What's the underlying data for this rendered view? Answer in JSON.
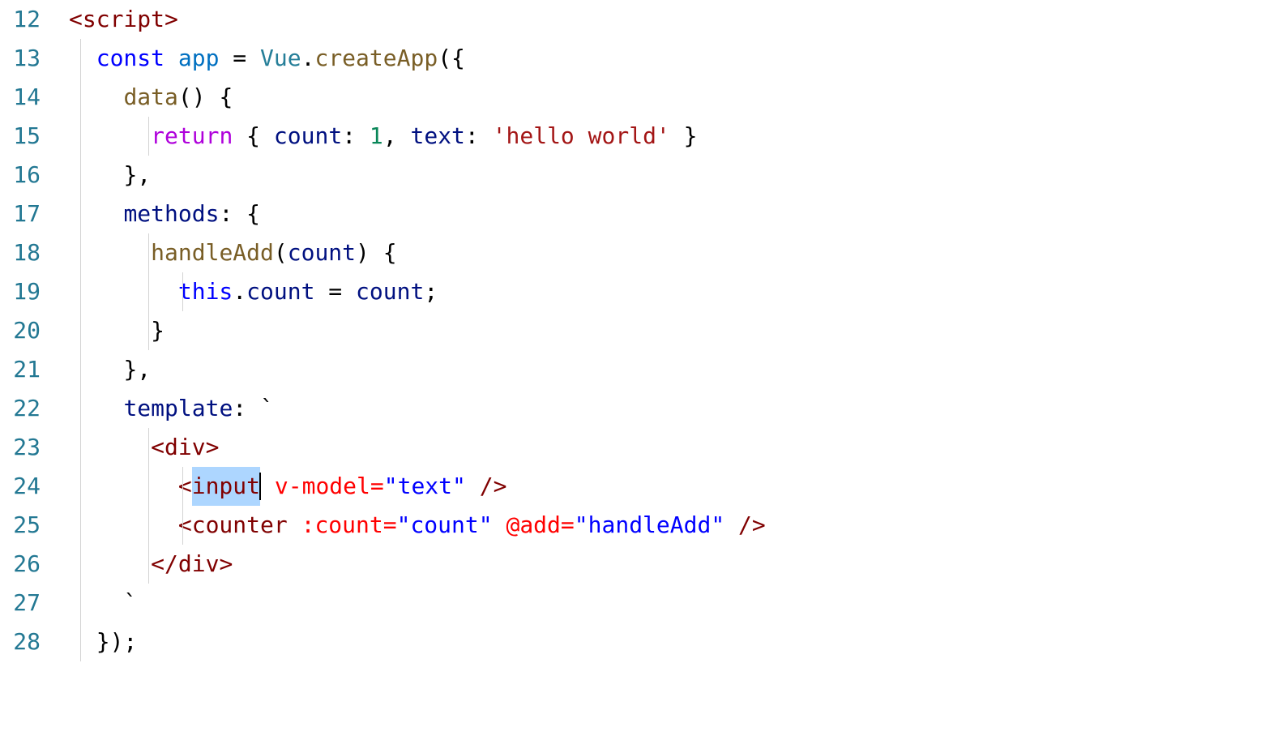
{
  "lineNumbers": [
    "12",
    "13",
    "14",
    "15",
    "16",
    "17",
    "18",
    "19",
    "20",
    "21",
    "22",
    "23",
    "24",
    "25",
    "26",
    "27",
    "28"
  ],
  "lines": {
    "l12": {
      "openBracket": "<",
      "tagName": "script",
      "closeBracket": ">"
    },
    "l13": {
      "keyword": "const",
      "variable": "app",
      "equals": " = ",
      "className": "Vue",
      "dot": ".",
      "method": "createApp",
      "paren": "({"
    },
    "l14": {
      "method": "data",
      "parens": "() {"
    },
    "l15": {
      "keyword": "return",
      "open": " { ",
      "prop1": "count",
      "colon1": ": ",
      "val1": "1",
      "comma": ", ",
      "prop2": "text",
      "colon2": ": ",
      "val2": "'hello world'",
      "close": " }"
    },
    "l16": {
      "close": "},"
    },
    "l17": {
      "prop": "methods",
      "colon": ": {"
    },
    "l18": {
      "method": "handleAdd",
      "open": "(",
      "param": "count",
      "close": ") {"
    },
    "l19": {
      "this": "this",
      "dot": ".",
      "prop": "count",
      "equals": " = ",
      "var": "count",
      "semi": ";"
    },
    "l20": {
      "close": "}"
    },
    "l21": {
      "close": "},"
    },
    "l22": {
      "prop": "template",
      "colon": ": ",
      "tick": "`"
    },
    "l23": {
      "open": "<",
      "tag": "div",
      "close": ">"
    },
    "l24": {
      "open": "<",
      "tag": "input",
      "attr": " v-model=",
      "val": "\"text\"",
      "close": " />"
    },
    "l25": {
      "open": "<",
      "tag": "counter",
      "attr1": " :count=",
      "val1": "\"count\"",
      "attr2": " @add=",
      "val2": "\"handleAdd\"",
      "close": " />"
    },
    "l26": {
      "open": "</",
      "tag": "div",
      "close": ">"
    },
    "l27": {
      "tick": "`"
    },
    "l28": {
      "close": "});"
    }
  },
  "selectedText": "input",
  "cursorLine": 24
}
